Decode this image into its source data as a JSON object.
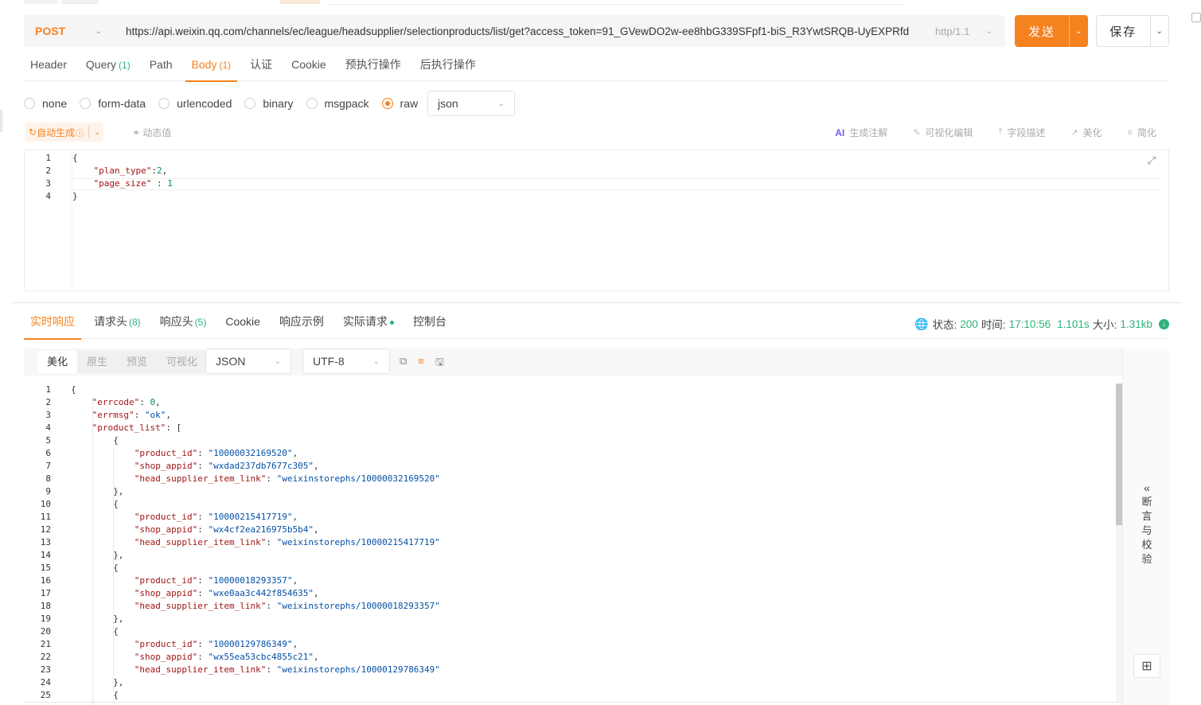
{
  "request": {
    "method": "POST",
    "url": "https://api.weixin.qq.com/channels/ec/league/headsupplier/selectionproducts/list/get?access_token=91_GVewDO2w-ee8hbG339SFpf1-biS_R3YwtSRQB-UyEXPRfd",
    "protocol": "http/1.1",
    "send_label": "发送",
    "save_label": "保存"
  },
  "request_tabs": [
    {
      "label": "Header",
      "count": ""
    },
    {
      "label": "Query",
      "count": "(1)"
    },
    {
      "label": "Path",
      "count": ""
    },
    {
      "label": "Body",
      "count": "(1)",
      "active": true
    },
    {
      "label": "认证",
      "count": ""
    },
    {
      "label": "Cookie",
      "count": ""
    },
    {
      "label": "预执行操作",
      "count": ""
    },
    {
      "label": "后执行操作",
      "count": ""
    }
  ],
  "body_types": [
    {
      "label": "none",
      "checked": false
    },
    {
      "label": "form-data",
      "checked": false
    },
    {
      "label": "urlencoded",
      "checked": false
    },
    {
      "label": "binary",
      "checked": false
    },
    {
      "label": "msgpack",
      "checked": false
    },
    {
      "label": "raw",
      "checked": true
    }
  ],
  "body_format": "json",
  "body_toolbar": {
    "auto_generate": "自动生成",
    "dynamic_value": "动态值",
    "ai_label": "AI",
    "tools": [
      "生成注解",
      "可视化编辑",
      "字段描述",
      "美化",
      "简化"
    ]
  },
  "request_body_lines": [
    [
      {
        "t": "p",
        "v": "{"
      }
    ],
    [
      {
        "t": "p",
        "v": "    "
      },
      {
        "t": "k",
        "v": "\"plan_type\""
      },
      {
        "t": "p",
        "v": ":"
      },
      {
        "t": "n",
        "v": "2"
      },
      {
        "t": "p",
        "v": ","
      }
    ],
    [
      {
        "t": "p",
        "v": "    "
      },
      {
        "t": "k",
        "v": "\"page_size\""
      },
      {
        "t": "p",
        "v": " : "
      },
      {
        "t": "n",
        "v": "1"
      }
    ],
    [
      {
        "t": "p",
        "v": "}"
      }
    ]
  ],
  "response_tabs": [
    {
      "label": "实时响应",
      "count": "",
      "active": true
    },
    {
      "label": "请求头",
      "count": "(8)"
    },
    {
      "label": "响应头",
      "count": "(5)"
    },
    {
      "label": "Cookie",
      "count": ""
    },
    {
      "label": "响应示例",
      "count": ""
    },
    {
      "label": "实际请求",
      "count": "",
      "dot": true
    },
    {
      "label": "控制台",
      "count": ""
    }
  ],
  "response_status": {
    "status_label": "状态:",
    "status_code": "200",
    "time_label": "时间:",
    "time": "17:10:56",
    "duration": "1.101s",
    "size_label": "大小:",
    "size": "1.31kb"
  },
  "response_view_modes": [
    {
      "label": "美化",
      "active": true
    },
    {
      "label": "原生"
    },
    {
      "label": "预览"
    },
    {
      "label": "可视化"
    }
  ],
  "response_format": "JSON",
  "response_encoding": "UTF-8",
  "response_lines": [
    {
      "i": 0,
      "tok": [
        {
          "t": "p",
          "v": "{"
        }
      ]
    },
    {
      "i": 1,
      "tok": [
        {
          "t": "k",
          "v": "\"errcode\""
        },
        {
          "t": "p",
          "v": ": "
        },
        {
          "t": "n",
          "v": "0"
        },
        {
          "t": "p",
          "v": ","
        }
      ]
    },
    {
      "i": 1,
      "tok": [
        {
          "t": "k",
          "v": "\"errmsg\""
        },
        {
          "t": "p",
          "v": ": "
        },
        {
          "t": "s",
          "v": "\"ok\""
        },
        {
          "t": "p",
          "v": ","
        }
      ]
    },
    {
      "i": 1,
      "tok": [
        {
          "t": "k",
          "v": "\"product_list\""
        },
        {
          "t": "p",
          "v": ": ["
        }
      ]
    },
    {
      "i": 2,
      "tok": [
        {
          "t": "p",
          "v": "{"
        }
      ]
    },
    {
      "i": 3,
      "tok": [
        {
          "t": "k",
          "v": "\"product_id\""
        },
        {
          "t": "p",
          "v": ": "
        },
        {
          "t": "s",
          "v": "\"10000032169520\""
        },
        {
          "t": "p",
          "v": ","
        }
      ]
    },
    {
      "i": 3,
      "tok": [
        {
          "t": "k",
          "v": "\"shop_appid\""
        },
        {
          "t": "p",
          "v": ": "
        },
        {
          "t": "s",
          "v": "\"wxdad237db7677c305\""
        },
        {
          "t": "p",
          "v": ","
        }
      ]
    },
    {
      "i": 3,
      "tok": [
        {
          "t": "k",
          "v": "\"head_supplier_item_link\""
        },
        {
          "t": "p",
          "v": ": "
        },
        {
          "t": "s",
          "v": "\"weixinstorephs/10000032169520\""
        }
      ]
    },
    {
      "i": 2,
      "tok": [
        {
          "t": "p",
          "v": "},"
        }
      ]
    },
    {
      "i": 2,
      "tok": [
        {
          "t": "p",
          "v": "{"
        }
      ]
    },
    {
      "i": 3,
      "tok": [
        {
          "t": "k",
          "v": "\"product_id\""
        },
        {
          "t": "p",
          "v": ": "
        },
        {
          "t": "s",
          "v": "\"10000215417719\""
        },
        {
          "t": "p",
          "v": ","
        }
      ]
    },
    {
      "i": 3,
      "tok": [
        {
          "t": "k",
          "v": "\"shop_appid\""
        },
        {
          "t": "p",
          "v": ": "
        },
        {
          "t": "s",
          "v": "\"wx4cf2ea216975b5b4\""
        },
        {
          "t": "p",
          "v": ","
        }
      ]
    },
    {
      "i": 3,
      "tok": [
        {
          "t": "k",
          "v": "\"head_supplier_item_link\""
        },
        {
          "t": "p",
          "v": ": "
        },
        {
          "t": "s",
          "v": "\"weixinstorephs/10000215417719\""
        }
      ]
    },
    {
      "i": 2,
      "tok": [
        {
          "t": "p",
          "v": "},"
        }
      ]
    },
    {
      "i": 2,
      "tok": [
        {
          "t": "p",
          "v": "{"
        }
      ]
    },
    {
      "i": 3,
      "tok": [
        {
          "t": "k",
          "v": "\"product_id\""
        },
        {
          "t": "p",
          "v": ": "
        },
        {
          "t": "s",
          "v": "\"10000018293357\""
        },
        {
          "t": "p",
          "v": ","
        }
      ]
    },
    {
      "i": 3,
      "tok": [
        {
          "t": "k",
          "v": "\"shop_appid\""
        },
        {
          "t": "p",
          "v": ": "
        },
        {
          "t": "s",
          "v": "\"wxe0aa3c442f854635\""
        },
        {
          "t": "p",
          "v": ","
        }
      ]
    },
    {
      "i": 3,
      "tok": [
        {
          "t": "k",
          "v": "\"head_supplier_item_link\""
        },
        {
          "t": "p",
          "v": ": "
        },
        {
          "t": "s",
          "v": "\"weixinstorephs/10000018293357\""
        }
      ]
    },
    {
      "i": 2,
      "tok": [
        {
          "t": "p",
          "v": "},"
        }
      ]
    },
    {
      "i": 2,
      "tok": [
        {
          "t": "p",
          "v": "{"
        }
      ]
    },
    {
      "i": 3,
      "tok": [
        {
          "t": "k",
          "v": "\"product_id\""
        },
        {
          "t": "p",
          "v": ": "
        },
        {
          "t": "s",
          "v": "\"10000129786349\""
        },
        {
          "t": "p",
          "v": ","
        }
      ]
    },
    {
      "i": 3,
      "tok": [
        {
          "t": "k",
          "v": "\"shop_appid\""
        },
        {
          "t": "p",
          "v": ": "
        },
        {
          "t": "s",
          "v": "\"wx55ea53cbc4855c21\""
        },
        {
          "t": "p",
          "v": ","
        }
      ]
    },
    {
      "i": 3,
      "tok": [
        {
          "t": "k",
          "v": "\"head_supplier_item_link\""
        },
        {
          "t": "p",
          "v": ": "
        },
        {
          "t": "s",
          "v": "\"weixinstorephs/10000129786349\""
        }
      ]
    },
    {
      "i": 2,
      "tok": [
        {
          "t": "p",
          "v": "},"
        }
      ]
    },
    {
      "i": 2,
      "tok": [
        {
          "t": "p",
          "v": "{"
        }
      ]
    }
  ],
  "assert_panel_label": "断言与校验",
  "colors": {
    "accent": "#f5811f",
    "success": "#2fb37c",
    "json_key": "#a31515",
    "json_string": "#0451a5",
    "json_number": "#09885a"
  }
}
